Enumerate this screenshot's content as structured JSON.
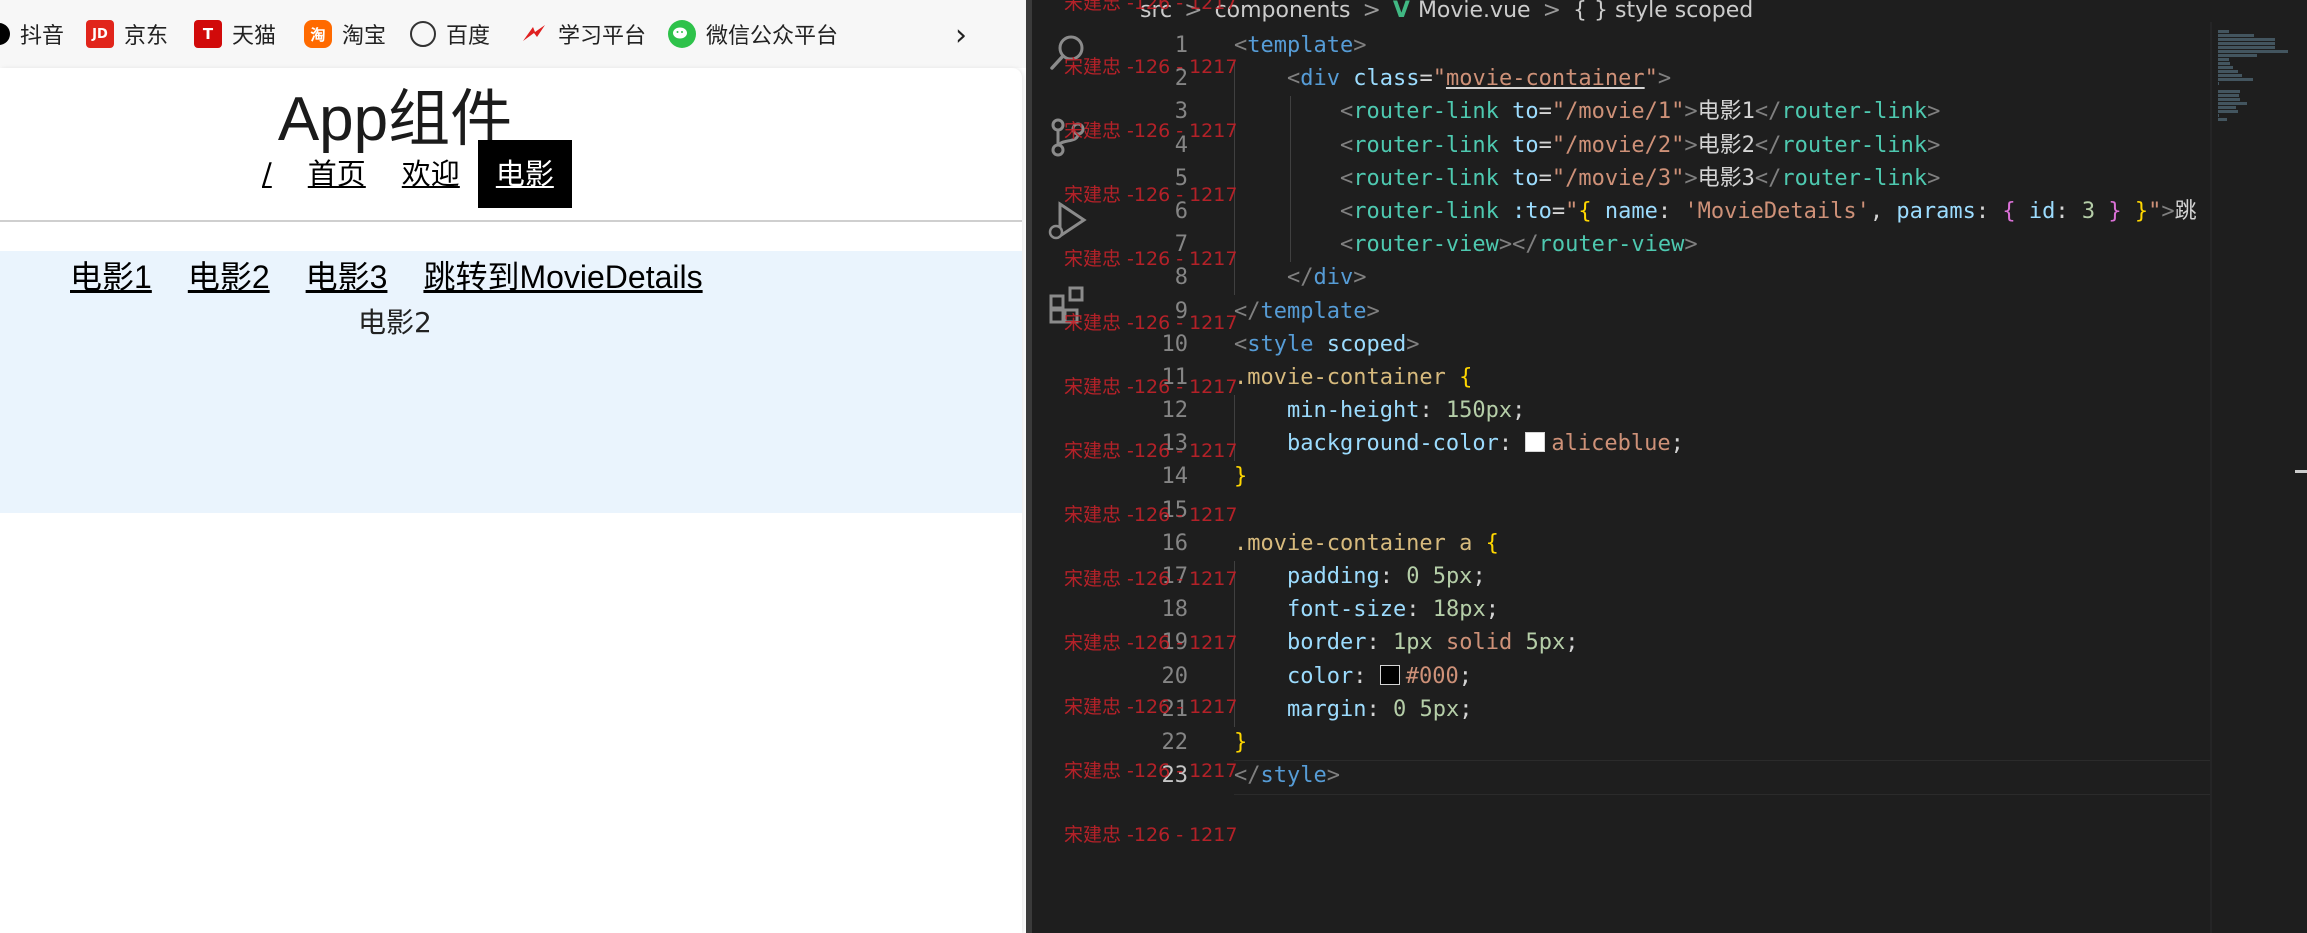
{
  "bookmarks": [
    {
      "label": "抖音",
      "icon": "douyin-icon"
    },
    {
      "label": "京东",
      "icon": "jd-icon",
      "badge": "JD"
    },
    {
      "label": "天猫",
      "icon": "tmall-icon",
      "badge": "T"
    },
    {
      "label": "淘宝",
      "icon": "taobao-icon",
      "badge": "淘"
    },
    {
      "label": "百度",
      "icon": "globe-icon"
    },
    {
      "label": "学习平台",
      "icon": "study-platform-icon"
    },
    {
      "label": "微信公众平台",
      "icon": "wechat-icon"
    }
  ],
  "bookmarks_more_glyph": "›",
  "app": {
    "title": "App组件",
    "nav": [
      {
        "label": "/",
        "active": false
      },
      {
        "label": "首页",
        "active": false
      },
      {
        "label": "欢迎",
        "active": false
      },
      {
        "label": "电影",
        "active": true
      }
    ],
    "movie_links": [
      "电影1",
      "电影2",
      "电影3",
      "跳转到MovieDetails"
    ],
    "router_view_text": "电影2",
    "container_bg": "#eaf4fd"
  },
  "breadcrumb": {
    "items": [
      "src",
      "components",
      "Movie.vue",
      "{ } style scoped"
    ],
    "separator": ">",
    "vue_icon_glyph": "V"
  },
  "editor": {
    "current_line": 23,
    "lines": [
      {
        "n": "1",
        "tokens": [
          [
            "t-punc",
            "<"
          ],
          [
            "t-tag",
            "template"
          ],
          [
            "t-punc",
            ">"
          ]
        ]
      },
      {
        "n": "2",
        "tokens": [
          [
            "t-text",
            "    "
          ],
          [
            "t-punc",
            "<"
          ],
          [
            "t-tag",
            "div"
          ],
          [
            "t-text",
            " "
          ],
          [
            "t-attr",
            "class"
          ],
          [
            "t-text",
            "="
          ],
          [
            "t-str",
            "\""
          ],
          [
            "t-str underline",
            "movie-container"
          ],
          [
            "t-str",
            "\""
          ],
          [
            "t-punc",
            ">"
          ]
        ]
      },
      {
        "n": "3",
        "tokens": [
          [
            "t-text",
            "        "
          ],
          [
            "t-punc",
            "<"
          ],
          [
            "t-comp",
            "router-link"
          ],
          [
            "t-text",
            " "
          ],
          [
            "t-attr",
            "to"
          ],
          [
            "t-text",
            "="
          ],
          [
            "t-str",
            "\"/movie/1\""
          ],
          [
            "t-punc",
            ">"
          ],
          [
            "t-text",
            "电影1"
          ],
          [
            "t-punc",
            "</"
          ],
          [
            "t-comp",
            "router-link"
          ],
          [
            "t-punc",
            ">"
          ]
        ]
      },
      {
        "n": "4",
        "tokens": [
          [
            "t-text",
            "        "
          ],
          [
            "t-punc",
            "<"
          ],
          [
            "t-comp",
            "router-link"
          ],
          [
            "t-text",
            " "
          ],
          [
            "t-attr",
            "to"
          ],
          [
            "t-text",
            "="
          ],
          [
            "t-str",
            "\"/movie/2\""
          ],
          [
            "t-punc",
            ">"
          ],
          [
            "t-text",
            "电影2"
          ],
          [
            "t-punc",
            "</"
          ],
          [
            "t-comp",
            "router-link"
          ],
          [
            "t-punc",
            ">"
          ]
        ]
      },
      {
        "n": "5",
        "tokens": [
          [
            "t-text",
            "        "
          ],
          [
            "t-punc",
            "<"
          ],
          [
            "t-comp",
            "router-link"
          ],
          [
            "t-text",
            " "
          ],
          [
            "t-attr",
            "to"
          ],
          [
            "t-text",
            "="
          ],
          [
            "t-str",
            "\"/movie/3\""
          ],
          [
            "t-punc",
            ">"
          ],
          [
            "t-text",
            "电影3"
          ],
          [
            "t-punc",
            "</"
          ],
          [
            "t-comp",
            "router-link"
          ],
          [
            "t-punc",
            ">"
          ]
        ]
      },
      {
        "n": "6",
        "tokens": [
          [
            "t-text",
            "        "
          ],
          [
            "t-punc",
            "<"
          ],
          [
            "t-comp",
            "router-link"
          ],
          [
            "t-text",
            " "
          ],
          [
            "t-attr",
            ":to"
          ],
          [
            "t-text",
            "="
          ],
          [
            "t-str",
            "\""
          ],
          [
            "t-brace",
            "{"
          ],
          [
            "t-text",
            " "
          ],
          [
            "t-attr",
            "name"
          ],
          [
            "t-text",
            ": "
          ],
          [
            "t-str",
            "'MovieDetails'"
          ],
          [
            "t-text",
            ", "
          ],
          [
            "t-attr",
            "params"
          ],
          [
            "t-text",
            ": "
          ],
          [
            "t-brace2",
            "{"
          ],
          [
            "t-text",
            " "
          ],
          [
            "t-attr",
            "id"
          ],
          [
            "t-text",
            ": "
          ],
          [
            "t-num",
            "3"
          ],
          [
            "t-text",
            " "
          ],
          [
            "t-brace2",
            "}"
          ],
          [
            "t-text",
            " "
          ],
          [
            "t-brace",
            "}"
          ],
          [
            "t-str",
            "\""
          ],
          [
            "t-punc",
            ">"
          ],
          [
            "t-text",
            "跳"
          ]
        ]
      },
      {
        "n": "7",
        "tokens": [
          [
            "t-text",
            "        "
          ],
          [
            "t-punc",
            "<"
          ],
          [
            "t-comp",
            "router-view"
          ],
          [
            "t-punc",
            "></"
          ],
          [
            "t-comp",
            "router-view"
          ],
          [
            "t-punc",
            ">"
          ]
        ]
      },
      {
        "n": "8",
        "tokens": [
          [
            "t-text",
            "    "
          ],
          [
            "t-punc",
            "</"
          ],
          [
            "t-tag",
            "div"
          ],
          [
            "t-punc",
            ">"
          ]
        ]
      },
      {
        "n": "9",
        "tokens": [
          [
            "t-punc",
            "</"
          ],
          [
            "t-tag",
            "template"
          ],
          [
            "t-punc",
            ">"
          ]
        ]
      },
      {
        "n": "10",
        "tokens": [
          [
            "t-punc",
            "<"
          ],
          [
            "t-tag",
            "style"
          ],
          [
            "t-text",
            " "
          ],
          [
            "t-attr",
            "scoped"
          ],
          [
            "t-punc",
            ">"
          ]
        ]
      },
      {
        "n": "11",
        "tokens": [
          [
            "t-sel",
            ".movie-container"
          ],
          [
            "t-text",
            " "
          ],
          [
            "t-brace",
            "{"
          ]
        ]
      },
      {
        "n": "12",
        "tokens": [
          [
            "t-text",
            "    "
          ],
          [
            "t-prop",
            "min-height"
          ],
          [
            "t-text",
            ": "
          ],
          [
            "t-num",
            "150px"
          ],
          [
            "t-text",
            ";"
          ]
        ]
      },
      {
        "n": "13",
        "tokens": [
          [
            "t-text",
            "    "
          ],
          [
            "t-prop",
            "background-color"
          ],
          [
            "t-text",
            ": "
          ],
          [
            "swatch-white",
            ""
          ],
          [
            "t-str",
            "aliceblue"
          ],
          [
            "t-text",
            ";"
          ]
        ]
      },
      {
        "n": "14",
        "tokens": [
          [
            "t-brace",
            "}"
          ]
        ]
      },
      {
        "n": "15",
        "tokens": []
      },
      {
        "n": "16",
        "tokens": [
          [
            "t-sel",
            ".movie-container a"
          ],
          [
            "t-text",
            " "
          ],
          [
            "t-brace",
            "{"
          ]
        ]
      },
      {
        "n": "17",
        "tokens": [
          [
            "t-text",
            "    "
          ],
          [
            "t-prop",
            "padding"
          ],
          [
            "t-text",
            ": "
          ],
          [
            "t-num",
            "0 5px"
          ],
          [
            "t-text",
            ";"
          ]
        ]
      },
      {
        "n": "18",
        "tokens": [
          [
            "t-text",
            "    "
          ],
          [
            "t-prop",
            "font-size"
          ],
          [
            "t-text",
            ": "
          ],
          [
            "t-num",
            "18px"
          ],
          [
            "t-text",
            ";"
          ]
        ]
      },
      {
        "n": "19",
        "tokens": [
          [
            "t-text",
            "    "
          ],
          [
            "t-prop",
            "border"
          ],
          [
            "t-text",
            ": "
          ],
          [
            "t-num",
            "1px"
          ],
          [
            "t-text",
            " "
          ],
          [
            "t-str",
            "solid"
          ],
          [
            "t-text",
            " "
          ],
          [
            "t-num",
            "5px"
          ],
          [
            "t-text",
            ";"
          ]
        ]
      },
      {
        "n": "20",
        "tokens": [
          [
            "t-text",
            "    "
          ],
          [
            "t-prop",
            "color"
          ],
          [
            "t-text",
            ": "
          ],
          [
            "swatch-black",
            ""
          ],
          [
            "t-str",
            "#000"
          ],
          [
            "t-text",
            ";"
          ]
        ]
      },
      {
        "n": "21",
        "tokens": [
          [
            "t-text",
            "    "
          ],
          [
            "t-prop",
            "margin"
          ],
          [
            "t-text",
            ": "
          ],
          [
            "t-num",
            "0 5px"
          ],
          [
            "t-text",
            ";"
          ]
        ]
      },
      {
        "n": "22",
        "tokens": [
          [
            "t-brace",
            "}"
          ]
        ]
      },
      {
        "n": "23",
        "tokens": [
          [
            "t-punc",
            "</"
          ],
          [
            "t-tag",
            "style"
          ],
          [
            "t-punc",
            ">"
          ]
        ]
      }
    ]
  },
  "watermark_text": "宋建忠 -126 - 1217",
  "watermark_rows": 14
}
